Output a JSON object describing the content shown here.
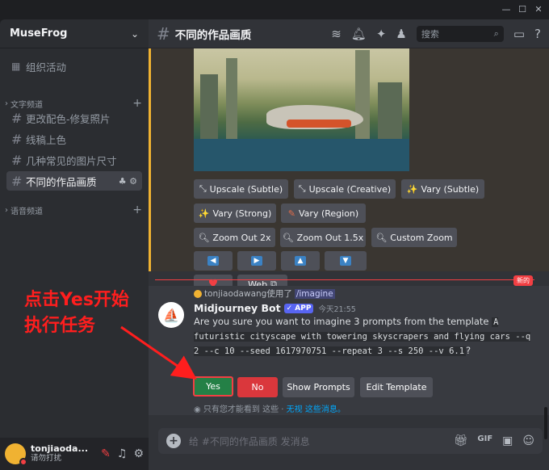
{
  "window": {
    "controls": [
      "—",
      "☐",
      "✕"
    ]
  },
  "sidebar": {
    "server_name": "MuseFrog",
    "top_item": "组织活动",
    "category_text": "文字频道",
    "category_voice": "语音频道",
    "channels": [
      {
        "label": "更改配色-修复照片"
      },
      {
        "label": "线稿上色"
      },
      {
        "label": "几种常见的图片尺寸"
      },
      {
        "label": "不同的作品画质"
      }
    ]
  },
  "user": {
    "name": "tonjiaoda...",
    "status": "请勿打扰"
  },
  "header": {
    "channel": "不同的作品画质",
    "search_placeholder": "搜索"
  },
  "image_buttons": {
    "row1": [
      "Upscale (Subtle)",
      "Upscale (Creative)",
      "Vary (Subtle)"
    ],
    "row2": [
      "Vary (Strong)",
      "Vary (Region)"
    ],
    "row3": [
      "Zoom Out 2x",
      "Zoom Out 1.5x",
      "Custom Zoom"
    ],
    "web": "Web"
  },
  "new_tag": "新的",
  "message": {
    "reply_user": "tonjiaodawang使用了",
    "reply_cmd": "imagine",
    "bot_name": "Midjourney Bot",
    "badge": "APP",
    "time": "今天21:55",
    "text_before": "Are you sure you want to imagine 3 prompts from the template",
    "code1": "A futuristic cityscape with towering skyscrapers and flying cars --q 2 --c 10 --seed 1617970751 --repeat 3  --s 250 --v 6.1",
    "text_after": "?",
    "buttons": {
      "yes": "Yes",
      "no": "No",
      "show": "Show Prompts",
      "edit": "Edit Template"
    },
    "ephemeral_text": "只有您才能看到 这些 · ",
    "ephemeral_link": "无视 这些消息。"
  },
  "composer": {
    "placeholder": "给 #不同的作品画质 发消息"
  },
  "annotation": {
    "line1": "点击Yes开始",
    "line2": "执行任务"
  },
  "colors": {
    "accent": "#5865f2",
    "yes": "#248046",
    "no": "#da373c",
    "annotation": "#ff1e1e"
  }
}
